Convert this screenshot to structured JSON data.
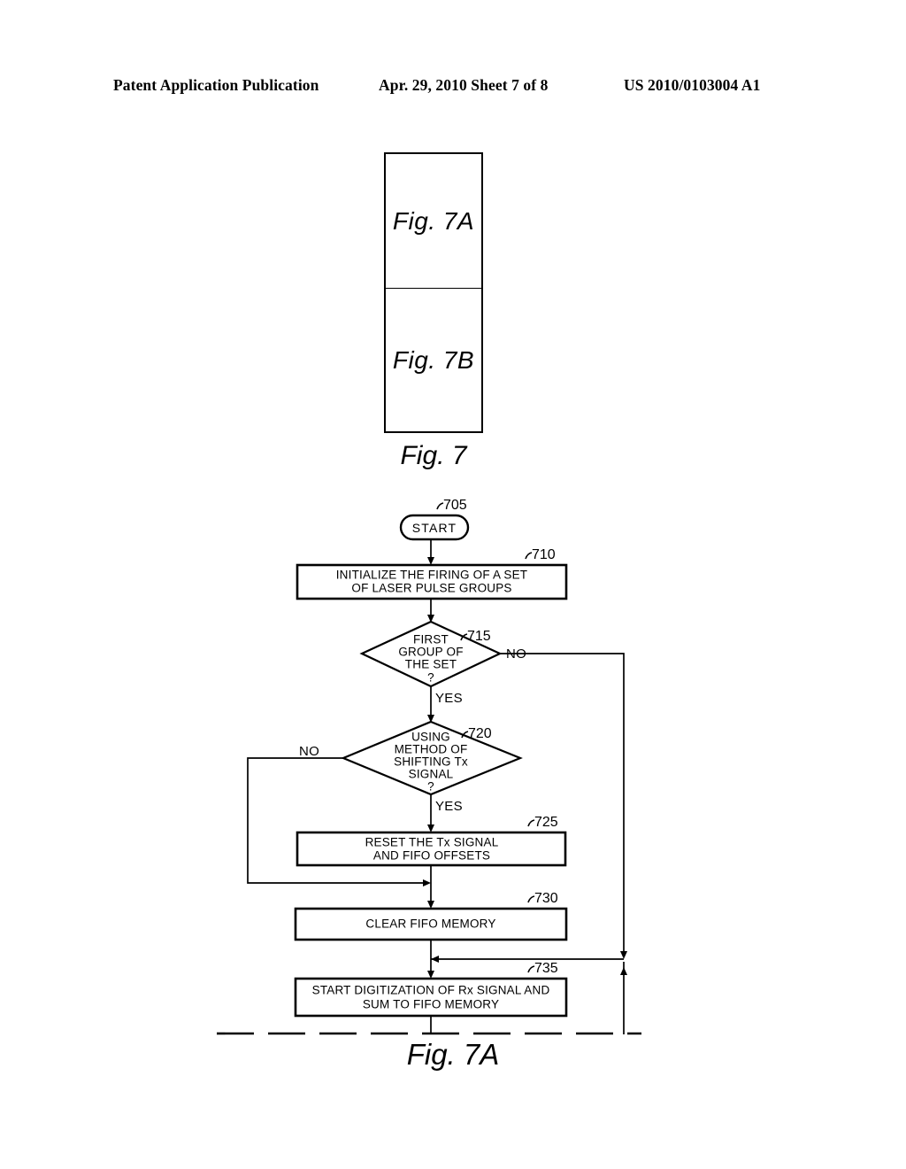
{
  "header": {
    "left": "Patent Application Publication",
    "middle": "Apr. 29, 2010  Sheet 7 of 8",
    "right": "US 2010/0103004 A1"
  },
  "key_box": {
    "top_label": "Fig. 7A",
    "bottom_label": "Fig. 7B",
    "caption": "Fig. 7"
  },
  "figure": {
    "caption": "Fig. 7A"
  },
  "flowchart": {
    "nodes": {
      "start": {
        "ref": "705",
        "label": "START",
        "shape": "terminator"
      },
      "init": {
        "ref": "710",
        "shape": "process",
        "lines": [
          "INITIALIZE THE FIRING OF A SET",
          "OF LASER PULSE GROUPS"
        ]
      },
      "first_group": {
        "ref": "715",
        "shape": "decision",
        "lines": [
          "FIRST",
          "GROUP OF",
          "THE SET",
          "?"
        ]
      },
      "shifting_tx": {
        "ref": "720",
        "shape": "decision",
        "lines": [
          "USING",
          "METHOD OF",
          "SHIFTING Tx",
          "SIGNAL",
          "?"
        ]
      },
      "reset": {
        "ref": "725",
        "shape": "process",
        "lines": [
          "RESET THE Tx SIGNAL",
          "AND FIFO OFFSETS"
        ]
      },
      "clear": {
        "ref": "730",
        "shape": "process",
        "lines": [
          "CLEAR FIFO MEMORY"
        ]
      },
      "digitize": {
        "ref": "735",
        "shape": "process",
        "lines": [
          "START DIGITIZATION OF Rx SIGNAL AND",
          "SUM TO FIFO MEMORY"
        ]
      }
    },
    "branch_labels": {
      "first_group_no": "NO",
      "first_group_yes": "YES",
      "shifting_tx_no": "NO",
      "shifting_tx_yes": "YES"
    }
  }
}
